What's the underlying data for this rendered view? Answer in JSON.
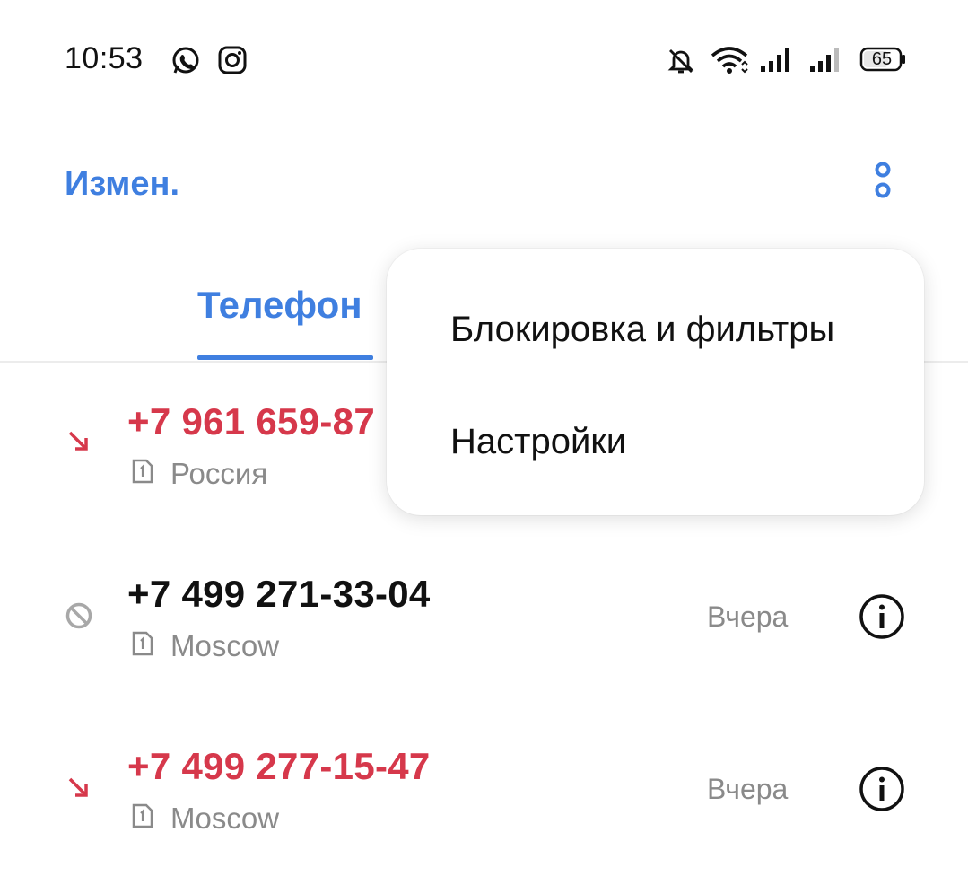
{
  "status_bar": {
    "time": "10:53",
    "battery": "65",
    "icons": [
      "whatsapp-icon",
      "instagram-icon",
      "bell-off-icon",
      "wifi-icon",
      "signal-icon",
      "signal-icon",
      "battery-icon"
    ]
  },
  "header": {
    "edit_label": "Измен.",
    "more_icon": "more-vertical-icon"
  },
  "tabs": [
    {
      "label": "Телефон",
      "active": true
    }
  ],
  "calls": [
    {
      "number": "+7 961 659-87",
      "location": "Россия",
      "type": "missed",
      "time": ""
    },
    {
      "number": "+7 499 271-33-04",
      "location": "Moscow",
      "type": "blocked",
      "time": "Вчера"
    },
    {
      "number": "+7 499 277-15-47",
      "location": "Moscow",
      "type": "missed",
      "time": "Вчера"
    }
  ],
  "menu": {
    "items": [
      {
        "label": "Блокировка и фильтры"
      },
      {
        "label": "Настройки"
      }
    ]
  },
  "colors": {
    "accent": "#3f7fe0",
    "missed": "#d6384b",
    "secondary_text": "#8a8a8a"
  }
}
